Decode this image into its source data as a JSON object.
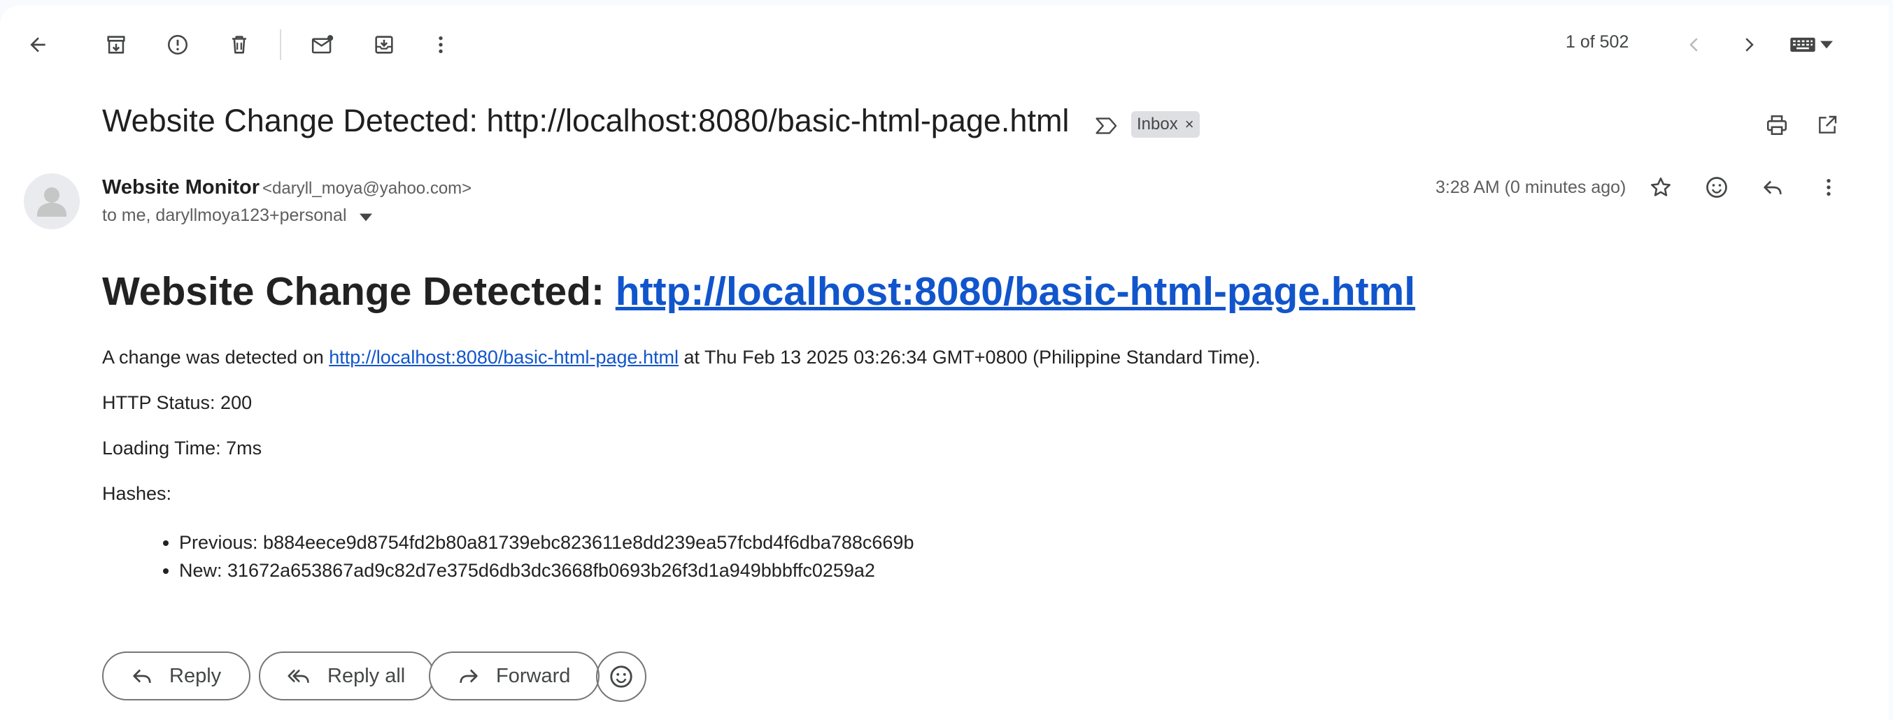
{
  "toolbar": {
    "back_icon": "arrow-back-icon",
    "archive_icon": "archive-icon",
    "report_icon": "report-spam-icon",
    "delete_icon": "trash-icon",
    "mark_unread_icon": "mark-unread-icon",
    "move_icon": "move-to-icon",
    "more_icon": "more-vert-icon"
  },
  "pager": {
    "count": "1 of 502"
  },
  "email": {
    "subject": "Website Change Detected: http://localhost:8080/basic-html-page.html",
    "label": "Inbox",
    "label_remove": "×",
    "sender_name": "Website Monitor",
    "sender_email": "<daryll_moya@yahoo.com>",
    "recipients": "to me, daryllmoya123+personal",
    "time": "3:28 AM (0 minutes ago)"
  },
  "body": {
    "heading_prefix": "Website Change Detected: ",
    "heading_link": "http://localhost:8080/basic-html-page.html",
    "change_prefix": "A change was detected on ",
    "change_link": "http://localhost:8080/basic-html-page.html",
    "change_suffix": " at Thu Feb 13 2025 03:26:34 GMT+0800 (Philippine Standard Time).",
    "http_status": "HTTP Status: 200",
    "loading_time": "Loading Time: 7ms",
    "hashes_label": "Hashes:",
    "hashes": [
      "Previous: b884eece9d8754fd2b80a81739ebc823611e8dd239ea57fcbd4f6dba788c669b",
      "New: 31672a653867ad9c82d7e375d6db3dc3668fb0693b26f3d1a949bbbffc0259a2"
    ]
  },
  "actions": {
    "reply": "Reply",
    "reply_all": "Reply all",
    "forward": "Forward"
  },
  "colors": {
    "link": "#1155cc",
    "label_chip": "#dddfe2",
    "text": "#1f1f1f"
  }
}
